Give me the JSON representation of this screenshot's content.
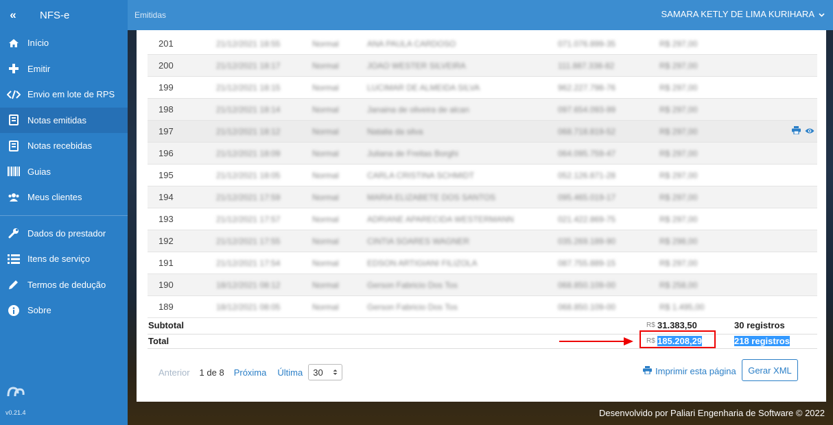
{
  "sidebar": {
    "brand": "NFS-e",
    "items": [
      {
        "label": "Início"
      },
      {
        "label": "Emitir"
      },
      {
        "label": "Envio em lote de RPS"
      },
      {
        "label": "Notas emitidas"
      },
      {
        "label": "Notas recebidas"
      },
      {
        "label": "Guias"
      },
      {
        "label": "Meus clientes"
      },
      {
        "label": "Dados do prestador"
      },
      {
        "label": "Itens de serviço"
      },
      {
        "label": "Termos de dedução"
      },
      {
        "label": "Sobre"
      }
    ],
    "version": "v0.21.4"
  },
  "topbar": {
    "breadcrumb": "Emitidas",
    "user": "SAMARA KETLY DE LIMA KURIHARA"
  },
  "table": {
    "rows": [
      {
        "num": "201",
        "date": "21/12/2021 18:55",
        "type": "Normal",
        "name": "ANA PAULA CARDOSO",
        "doc": "071.076.899-35",
        "value": "R$ 297,00"
      },
      {
        "num": "200",
        "date": "21/12/2021 18:17",
        "type": "Normal",
        "name": "JOAO WESTER SILVEIRA",
        "doc": "111.887.338-82",
        "value": "R$ 297,00"
      },
      {
        "num": "199",
        "date": "21/12/2021 18:15",
        "type": "Normal",
        "name": "LUCIMAR DE ALMEIDA SILVA",
        "doc": "962.227.798-76",
        "value": "R$ 297,00"
      },
      {
        "num": "198",
        "date": "21/12/2021 18:14",
        "type": "Normal",
        "name": "Janaina de oliveira de alcan",
        "doc": "097.654.093-99",
        "value": "R$ 297,00"
      },
      {
        "num": "197",
        "date": "21/12/2021 18:12",
        "type": "Normal",
        "name": "Natalia da silva",
        "doc": "068.718.819-52",
        "value": "R$ 297,00"
      },
      {
        "num": "196",
        "date": "21/12/2021 18:09",
        "type": "Normal",
        "name": "Juliana de Freitas Borghi",
        "doc": "064.095.759-47",
        "value": "R$ 297,00"
      },
      {
        "num": "195",
        "date": "21/12/2021 18:05",
        "type": "Normal",
        "name": "CARLA CRISTINA SCHMIDT",
        "doc": "052.126.871-28",
        "value": "R$ 297,00"
      },
      {
        "num": "194",
        "date": "21/12/2021 17:59",
        "type": "Normal",
        "name": "MARIA ELIZABETE DOS SANTOS",
        "doc": "095.465.019-17",
        "value": "R$ 297,00"
      },
      {
        "num": "193",
        "date": "21/12/2021 17:57",
        "type": "Normal",
        "name": "ADRIANE APARECIDA WESTERMANN",
        "doc": "021.422.869-75",
        "value": "R$ 297,00"
      },
      {
        "num": "192",
        "date": "21/12/2021 17:55",
        "type": "Normal",
        "name": "CINTIA SOARES WAGNER",
        "doc": "035.269.189-90",
        "value": "R$ 298,00"
      },
      {
        "num": "191",
        "date": "21/12/2021 17:54",
        "type": "Normal",
        "name": "EDSON ARTIGIANI FILIZOLA",
        "doc": "087.755.889-15",
        "value": "R$ 297,00"
      },
      {
        "num": "190",
        "date": "18/12/2021 08:12",
        "type": "Normal",
        "name": "Gerson Fabricio Dos Tos",
        "doc": "068.850.109-00",
        "value": "R$ 258,00"
      },
      {
        "num": "189",
        "date": "18/12/2021 08:05",
        "type": "Normal",
        "name": "Gerson Fabricio Dos Tos",
        "doc": "068.850.109-00",
        "value": "R$ 1.495,00"
      }
    ]
  },
  "summary": {
    "subtotal_label": "Subtotal",
    "subtotal_currency": "R$",
    "subtotal_value": "31.383,50",
    "subtotal_count": "30 registros",
    "total_label": "Total",
    "total_currency": "R$",
    "total_value": "185.208,29",
    "total_count": "218 registros"
  },
  "pager": {
    "prev": "Anterior",
    "info": "1 de 8",
    "next": "Próxima",
    "last": "Última",
    "page_size": "30"
  },
  "actions": {
    "print": "Imprimir esta página",
    "xml": "Gerar XML"
  },
  "footer": "Desenvolvido por Paliari Engenharia de Software © 2022",
  "colors": {
    "sidebar": "#2b7fc7",
    "topbar": "#3c8dd0",
    "accent": "#2b7fc7",
    "highlight_box": "#e00000",
    "selection": "#3399ff"
  }
}
